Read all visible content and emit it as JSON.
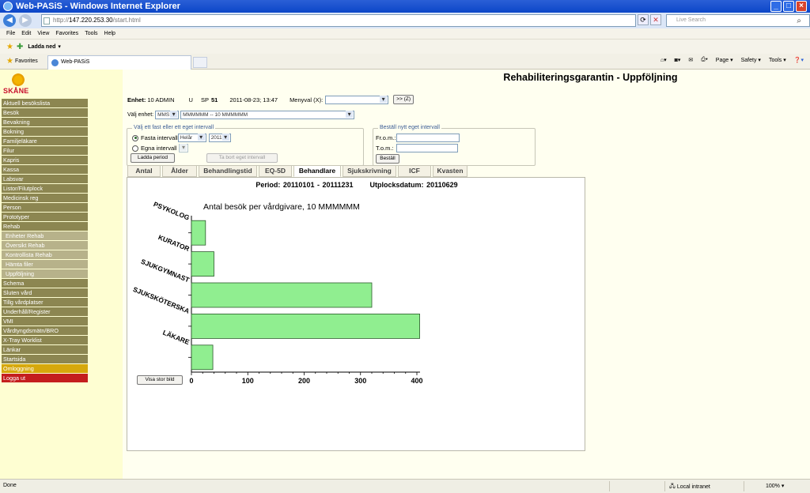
{
  "browser": {
    "window_title": "Web-PASiS - Windows Internet Explorer",
    "url_prefix": "http://",
    "url_host": "147.220.253.30",
    "url_path": "/start.html",
    "search_placeholder": "Live Search",
    "menu": [
      "File",
      "Edit",
      "View",
      "Favorites",
      "Tools",
      "Help"
    ],
    "toolbar_download": "Ladda ned",
    "favorites_label": "Favorites",
    "tab_title": "Web-PASiS",
    "cmd": [
      "Page",
      "Safety",
      "Tools"
    ],
    "status_text": "Done",
    "zone": "Local intranet",
    "zoom": "100%"
  },
  "logo_text": "SKÅNE",
  "sidebar": [
    {
      "label": "Aktuell besökslista",
      "type": "item"
    },
    {
      "label": "Besök",
      "type": "item"
    },
    {
      "label": "Bevakning",
      "type": "item"
    },
    {
      "label": "Bokning",
      "type": "item"
    },
    {
      "label": "Familjeläkare",
      "type": "item"
    },
    {
      "label": "Filur",
      "type": "item"
    },
    {
      "label": "Kapris",
      "type": "item"
    },
    {
      "label": "Kassa",
      "type": "item"
    },
    {
      "label": "Labsvar",
      "type": "item"
    },
    {
      "label": "Listor/Filutplock",
      "type": "item"
    },
    {
      "label": "Medicinsk reg",
      "type": "item"
    },
    {
      "label": "Person",
      "type": "item"
    },
    {
      "label": "Prototyper",
      "type": "item"
    },
    {
      "label": "Rehab",
      "type": "item"
    },
    {
      "label": "Enheter Rehab",
      "type": "sub"
    },
    {
      "label": "Översikt Rehab",
      "type": "sub"
    },
    {
      "label": "Kontrollista Rehab",
      "type": "sub"
    },
    {
      "label": "Hämta filer",
      "type": "sub"
    },
    {
      "label": "Uppföljning",
      "type": "sub"
    },
    {
      "label": "Schema",
      "type": "item"
    },
    {
      "label": "Sluten vård",
      "type": "item"
    },
    {
      "label": "Tillg vårdplatser",
      "type": "item"
    },
    {
      "label": "Underhåll/Register",
      "type": "item"
    },
    {
      "label": "VMI",
      "type": "item"
    },
    {
      "label": "Vårdtyngdsmätn/BRO",
      "type": "item"
    },
    {
      "label": "X-Tray Worklist",
      "type": "item"
    },
    {
      "label": "Länkar",
      "type": "item"
    },
    {
      "label": "Startsida",
      "type": "item"
    },
    {
      "label": "Omloggning",
      "type": "omlogg"
    },
    {
      "label": "Logga ut",
      "type": "logout"
    }
  ],
  "page": {
    "title": "Rehabiliteringsgarantin - Uppföljning",
    "enhet_label": "Enhet:",
    "enhet_value": "10 ADMIN",
    "u_label": "U",
    "sp_label": "SP",
    "sp_value": "51",
    "datetime": "2011-08-23; 13:47",
    "menyval_label": "Menyval (X):",
    "menyval_value": "",
    "go_button": ">> (Z)",
    "valj_enhet_label": "Välj enhet:",
    "enhet_type": "MMS",
    "enhet_select": "MMMMMM -- 10 MMMMMM"
  },
  "interval": {
    "legend": "Välj ett fast eller ett eget intervall",
    "fasta_label": "Fasta intervall",
    "fasta_period": "Helår",
    "fasta_year": "2011",
    "egna_label": "Egna intervall",
    "load_button": "Ladda period",
    "remove_button": "Ta bort eget intervall"
  },
  "order": {
    "legend": "Beställ nytt eget intervall",
    "from_label": "Fr.o.m.:",
    "to_label": "T.o.m.:",
    "button": "Beställ"
  },
  "tabs": [
    {
      "label": "Antal",
      "active": false
    },
    {
      "label": "Ålder",
      "active": false
    },
    {
      "label": "Behandlingstid",
      "active": false
    },
    {
      "label": "EQ-5D",
      "active": false
    },
    {
      "label": "Behandlare",
      "active": true
    },
    {
      "label": "Sjukskrivning",
      "active": false
    },
    {
      "label": "ICF",
      "active": false
    },
    {
      "label": "Kvasten",
      "active": false
    }
  ],
  "panel": {
    "period_label": "Period:",
    "period_value": "20110101 - 20111231",
    "utplock_label": "Utplocksdatum:",
    "utplock_value": "20110629",
    "big_image_button": "Visa stor bild"
  },
  "chart_data": {
    "type": "bar",
    "orientation": "horizontal",
    "title": "Antal besök per vårdgivare, 10 MMMMMM",
    "categories": [
      "PSYKOLOG",
      "KURATOR",
      "SJUKGYMNAST",
      "SJUKSKÖTERSKA",
      "LÄKARE"
    ],
    "values": [
      25,
      40,
      320,
      405,
      38
    ],
    "xlim": [
      0,
      420
    ],
    "xticks": [
      0,
      100,
      200,
      300,
      400
    ],
    "bar_color": "#90ee90",
    "grid": false
  }
}
